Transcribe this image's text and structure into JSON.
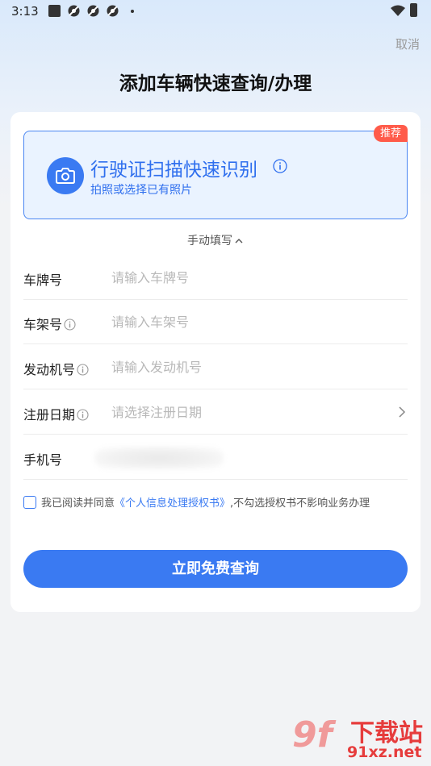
{
  "status_bar": {
    "time": "3:13"
  },
  "header": {
    "cancel_label": "取消",
    "title": "添加车辆快速查询/办理"
  },
  "scan": {
    "badge": "推荐",
    "title": "行驶证扫描快速识别",
    "subtitle": "拍照或选择已有照片"
  },
  "manual_toggle": {
    "label": "手动填写"
  },
  "fields": [
    {
      "label": "车牌号",
      "placeholder": "请输入车牌号"
    },
    {
      "label": "车架号",
      "placeholder": "请输入车架号"
    },
    {
      "label": "发动机号",
      "placeholder": "请输入发动机号"
    },
    {
      "label": "注册日期",
      "placeholder": "请选择注册日期"
    },
    {
      "label": "手机号",
      "placeholder": ""
    }
  ],
  "agreement": {
    "prefix": "我已阅读并同意",
    "link": "《个人信息处理授权书》",
    "suffix": ",不勾选授权书不影响业务办理"
  },
  "submit": {
    "label": "立即免费查询"
  },
  "watermark": {
    "logo": "9f",
    "title": "下载站",
    "url": "91xz.net"
  },
  "colors": {
    "accent": "#3a7af2",
    "badge": "#ff5b4a",
    "watermark": "#e63c3c"
  }
}
